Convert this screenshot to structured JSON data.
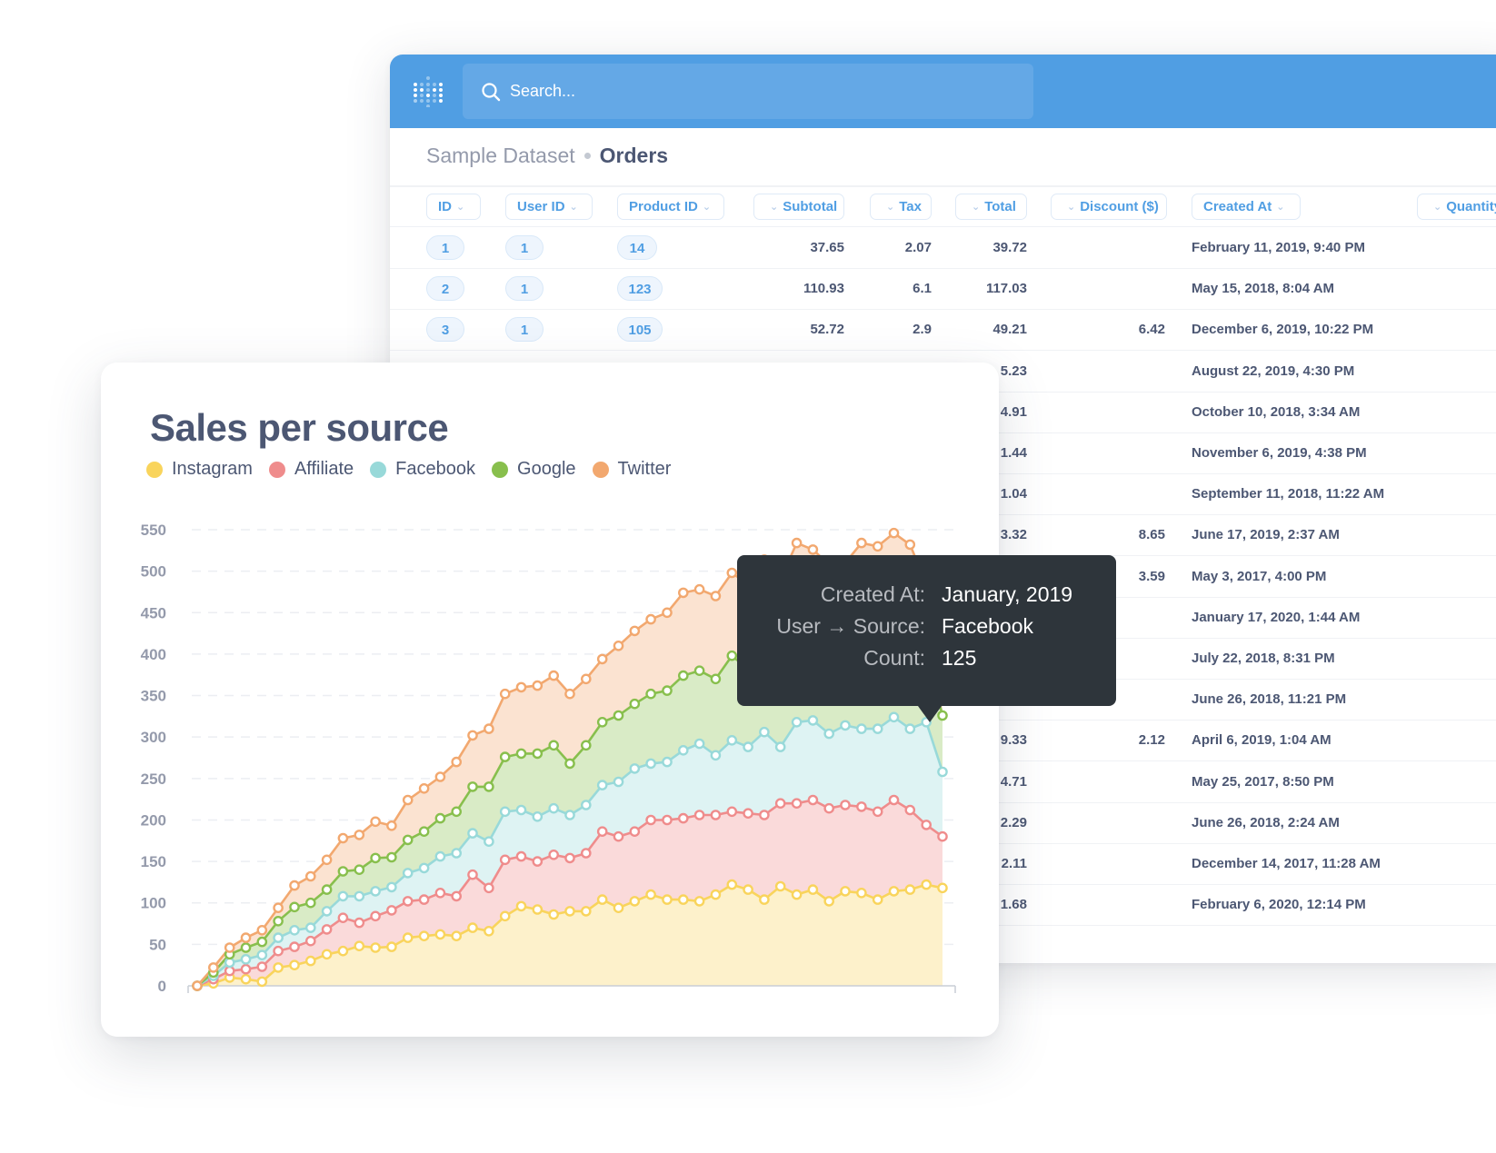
{
  "app": {
    "search": {
      "placeholder": "Search..."
    },
    "breadcrumb": {
      "parent": "Sample Dataset",
      "current": "Orders"
    }
  },
  "table": {
    "columns": [
      {
        "label": "ID",
        "chevron": "right"
      },
      {
        "label": "User ID",
        "chevron": "right"
      },
      {
        "label": "Product ID",
        "chevron": "right"
      },
      {
        "label": "Subtotal",
        "chevron": "left"
      },
      {
        "label": "Tax",
        "chevron": "left"
      },
      {
        "label": "Total",
        "chevron": "left"
      },
      {
        "label": "Discount ($)",
        "chevron": "left"
      },
      {
        "label": "Created At",
        "chevron": "right"
      },
      {
        "label": "Quantity",
        "chevron": "left"
      }
    ],
    "rows": [
      {
        "id": "1",
        "user_id": "1",
        "product_id": "14",
        "subtotal": "37.65",
        "tax": "2.07",
        "total": "39.72",
        "discount": "",
        "created_at": "February 11, 2019, 9:40 PM"
      },
      {
        "id": "2",
        "user_id": "1",
        "product_id": "123",
        "subtotal": "110.93",
        "tax": "6.1",
        "total": "117.03",
        "discount": "",
        "created_at": "May 15, 2018, 8:04 AM"
      },
      {
        "id": "3",
        "user_id": "1",
        "product_id": "105",
        "subtotal": "52.72",
        "tax": "2.9",
        "total": "49.21",
        "discount": "6.42",
        "created_at": "December 6, 2019, 10:22 PM"
      },
      {
        "total": "5.23",
        "discount": "",
        "created_at": "August 22, 2019, 4:30 PM"
      },
      {
        "total": "4.91",
        "discount": "",
        "created_at": "October 10, 2018, 3:34 AM"
      },
      {
        "total": "1.44",
        "discount": "",
        "created_at": "November 6, 2019, 4:38 PM"
      },
      {
        "total": "1.04",
        "discount": "",
        "created_at": "September 11, 2018, 11:22 AM"
      },
      {
        "total": "3.32",
        "discount": "8.65",
        "created_at": "June 17, 2019, 2:37 AM"
      },
      {
        "total": "",
        "discount": "3.59",
        "created_at": "May 3, 2017, 4:00 PM"
      },
      {
        "total": "",
        "discount": "",
        "created_at": "January 17, 2020, 1:44 AM"
      },
      {
        "total": "",
        "discount": "",
        "created_at": "July 22, 2018, 8:31 PM"
      },
      {
        "total": "",
        "discount": "",
        "created_at": "June 26, 2018, 11:21 PM"
      },
      {
        "total": "9.33",
        "discount": "2.12",
        "created_at": "April 6, 2019, 1:04 AM"
      },
      {
        "total": "4.71",
        "discount": "",
        "created_at": "May 25, 2017, 8:50 PM"
      },
      {
        "total": "2.29",
        "discount": "",
        "created_at": "June 26, 2018, 2:24 AM"
      },
      {
        "total": "2.11",
        "discount": "",
        "created_at": "December 14, 2017, 11:28 AM"
      },
      {
        "total": "1.68",
        "discount": "",
        "created_at": "February 6, 2020, 12:14 PM"
      }
    ]
  },
  "tooltip": {
    "rows": [
      {
        "label": "Created At:",
        "value": "January, 2019"
      },
      {
        "label": "User → Source:",
        "value": "Facebook"
      },
      {
        "label": "Count:",
        "value": "125"
      }
    ]
  },
  "chart_data": {
    "type": "area",
    "stacked": true,
    "title": "Sales per source",
    "xlabel": "",
    "ylabel": "",
    "ylim": [
      0,
      560
    ],
    "yticks": [
      0,
      50,
      100,
      150,
      200,
      250,
      300,
      350,
      400,
      450,
      500,
      550
    ],
    "grid": true,
    "legend_position": "top-left",
    "point_count": 47,
    "series": [
      {
        "name": "Instagram",
        "color": "#f9d45c",
        "values": [
          0,
          3,
          10,
          8,
          5,
          22,
          25,
          30,
          38,
          42,
          48,
          46,
          47,
          58,
          60,
          62,
          60,
          70,
          66,
          84,
          96,
          92,
          86,
          90,
          90,
          104,
          94,
          102,
          110,
          104,
          104,
          102,
          110,
          122,
          116,
          104,
          120,
          110,
          116,
          102,
          114,
          112,
          104,
          114,
          116,
          122,
          118
        ]
      },
      {
        "name": "Affiliate",
        "color": "#ef8c8c",
        "values": [
          0,
          5,
          8,
          12,
          18,
          20,
          22,
          24,
          30,
          40,
          28,
          38,
          44,
          44,
          44,
          50,
          48,
          64,
          52,
          68,
          60,
          58,
          72,
          64,
          70,
          82,
          86,
          84,
          90,
          96,
          98,
          104,
          96,
          88,
          92,
          102,
          100,
          110,
          108,
          112,
          104,
          104,
          106,
          110,
          96,
          72,
          62
        ]
      },
      {
        "name": "Facebook",
        "color": "#98d9d9",
        "values": [
          0,
          4,
          10,
          12,
          14,
          16,
          20,
          16,
          22,
          26,
          32,
          30,
          28,
          34,
          38,
          44,
          52,
          50,
          56,
          58,
          56,
          54,
          56,
          52,
          58,
          56,
          66,
          76,
          68,
          70,
          82,
          86,
          72,
          86,
          80,
          100,
          68,
          98,
          96,
          90,
          96,
          94,
          100,
          100,
          98,
          124,
          78
        ]
      },
      {
        "name": "Google",
        "color": "#88bf4d",
        "values": [
          0,
          4,
          10,
          14,
          16,
          20,
          28,
          30,
          26,
          30,
          32,
          40,
          36,
          40,
          44,
          46,
          50,
          56,
          66,
          66,
          68,
          76,
          76,
          62,
          72,
          76,
          80,
          78,
          84,
          86,
          90,
          88,
          92,
          102,
          94,
          100,
          96,
          112,
          110,
          100,
          92,
          112,
          114,
          112,
          104,
          82,
          68
        ]
      },
      {
        "name": "Twitter",
        "color": "#f2a86f",
        "values": [
          0,
          6,
          8,
          12,
          14,
          16,
          26,
          32,
          36,
          40,
          42,
          44,
          38,
          48,
          52,
          50,
          60,
          62,
          70,
          76,
          80,
          82,
          84,
          84,
          80,
          76,
          84,
          88,
          90,
          94,
          100,
          98,
          100,
          100,
          102,
          108,
          106,
          104,
          96,
          104,
          104,
          112,
          106,
          110,
          118,
          84,
          110
        ]
      }
    ]
  }
}
